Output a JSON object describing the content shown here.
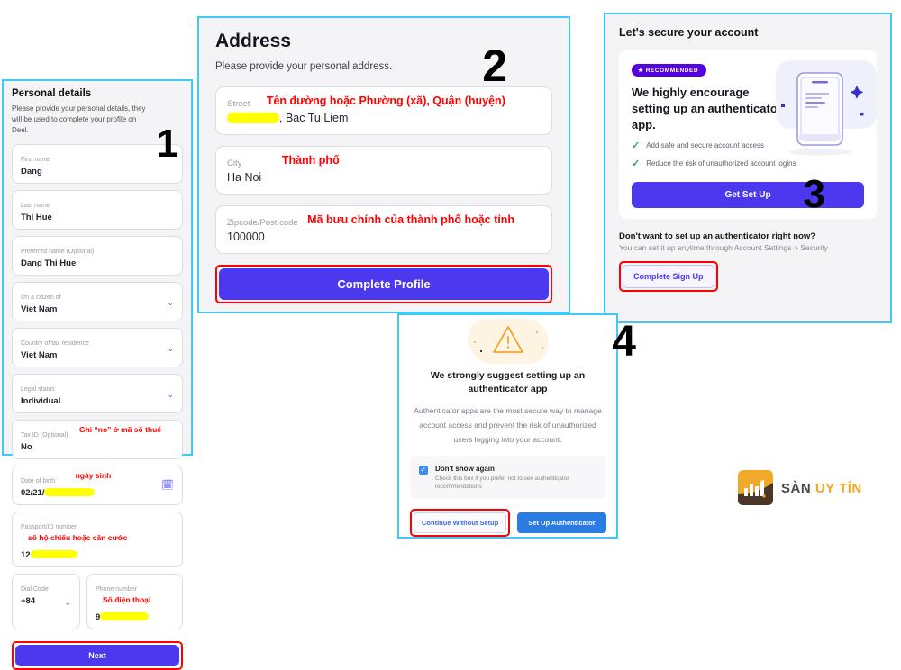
{
  "annotations": {
    "step1": "1",
    "step2": "2",
    "step3": "3",
    "step4": "4"
  },
  "panel1": {
    "title": "Personal details",
    "intro": "Please provide your personal details, they will be used to complete your profile on Deel.",
    "fields": [
      {
        "label": "First name",
        "value": "Dang",
        "note": "",
        "type": "text"
      },
      {
        "label": "Last name",
        "value": "Thi Hue",
        "note": "",
        "type": "text"
      },
      {
        "label": "Preferred name (Optional)",
        "value": "Dang Thi Hue",
        "note": "",
        "type": "text"
      },
      {
        "label": "I'm a citizen of",
        "value": "Viet Nam",
        "note": "",
        "type": "select"
      },
      {
        "label": "Country of tax residence",
        "value": "Viet Nam",
        "note": "",
        "type": "select"
      },
      {
        "label": "Legal status",
        "value": "Individual",
        "note": "",
        "type": "select"
      },
      {
        "label": "Tax ID (Optional)",
        "value": "No",
        "note": "Ghi “no” ở mã số thuế",
        "type": "text"
      },
      {
        "label": "Date of birth",
        "value": "02/21/",
        "note": "ngày sinh",
        "type": "date"
      },
      {
        "label": "Passport/ID number",
        "value": "12",
        "note": "số hộ chiếu hoặc căn cước",
        "type": "text"
      }
    ],
    "dial_code": {
      "label": "Dial Code",
      "value": "+84"
    },
    "phone": {
      "label": "Phone number",
      "value": "9",
      "note": "Số điện thoại"
    },
    "next_button": "Next"
  },
  "panel2": {
    "title": "Address",
    "subtitle": "Please provide your personal address.",
    "fields": [
      {
        "label": "Street",
        "value": ", Bac Tu Liem",
        "note": "Tên đường hoặc Phường (xã), Quận (huyện)",
        "redacted": true
      },
      {
        "label": "City",
        "value": "Ha Noi",
        "note": "Thành phố",
        "redacted": false
      },
      {
        "label": "Zipcode/Post code",
        "value": "100000",
        "note": "Mã bưu chính của thành phố hoặc tỉnh",
        "redacted": false
      }
    ],
    "complete_button": "Complete Profile"
  },
  "panel3": {
    "title": "Let's secure your account",
    "badge": "RECOMMENDED",
    "heading": "We highly encourage setting up an authenticator app.",
    "benefits": [
      "Add safe and secure account access",
      "Reduce the risk of unauthorized account logins"
    ],
    "get_set_up_button": "Get Set Up",
    "question": "Don't want to set up an authenticator right now?",
    "question_sub": "You can set it up anytime through Account Settings > Security",
    "complete_signup_button": "Complete Sign Up"
  },
  "panel4": {
    "heading": "We strongly suggest setting up an authenticator app",
    "body": "Authenticator apps are the most secure way to manage account access and prevent the risk of unauthorized users logging into your account.",
    "checkbox_title": "Don't show again",
    "checkbox_sub": "Check this box if you prefer not to see authenticator recommendations",
    "continue_button": "Continue Without Setup",
    "setup_button": "Set Up Authenticator"
  },
  "logo": {
    "text_primary": "SÀN",
    "text_secondary": "UY TÍN"
  },
  "colors": {
    "deel_purple": "#4b38ef",
    "badge_purple": "#5500dd",
    "modal_blue": "#2b7ce0",
    "annotation_red": "#ff0000",
    "panel_border_cyan": "#44c8f5",
    "redact_yellow": "#ffff00",
    "logo_orange": "#f2a829",
    "check_green": "#2faa4a",
    "warning_orange": "#f5a623"
  }
}
